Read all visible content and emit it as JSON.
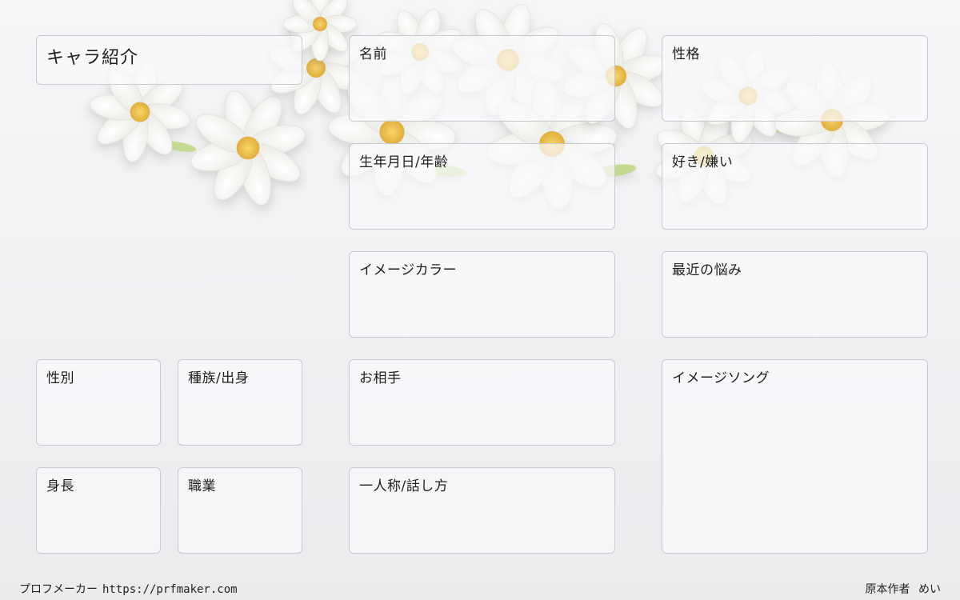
{
  "title": "キャラ紹介",
  "fields": {
    "name": "名前",
    "personality": "性格",
    "birthday_age": "生年月日/年齢",
    "likes_dislikes": "好き/嫌い",
    "image_color": "イメージカラー",
    "recent_worry": "最近の悩み",
    "gender": "性別",
    "race_origin": "種族/出身",
    "partner": "お相手",
    "image_song": "イメージソング",
    "height": "身長",
    "occupation": "職業",
    "first_person_speech": "一人称/話し方"
  },
  "footer": {
    "site_name": "プロフメーカー",
    "url": "https://prfmaker.com",
    "author_label": "原本作者",
    "author_name": "めい"
  },
  "colors": {
    "petal": "#ffffff",
    "flower_center": "#f0c24a",
    "leaf": "#bcd67a",
    "box_border": "#c9c9cf"
  },
  "icons": [
    "white-cosmos-flower-decoration"
  ]
}
